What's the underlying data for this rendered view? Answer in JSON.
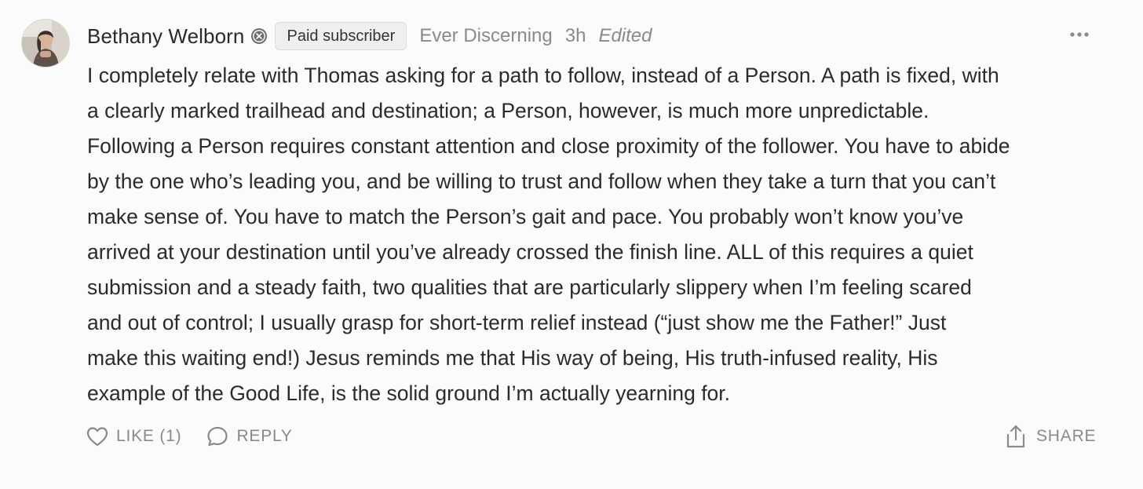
{
  "comment": {
    "author": "Bethany Welborn",
    "badge": "Paid subscriber",
    "publication": "Ever Discerning",
    "time": "3h",
    "edited": "Edited",
    "lines": [
      "I completely relate with Thomas asking for a path to follow, instead of a Person. A path is fixed, with",
      "a clearly marked trailhead and destination; a Person, however, is much more unpredictable.",
      "Following a Person requires constant attention and close proximity of the follower. You have to abide",
      "by the one who’s leading you, and be willing to trust and follow when they take a turn that you can’t",
      "make sense of. You have to match the Person’s gait and pace. You probably won’t know you’ve",
      "arrived at your destination until you’ve already crossed the finish line. ALL of this requires a quiet",
      "submission and a steady faith, two qualities that are particularly slippery when I’m feeling scared",
      "and out of control; I usually grasp for short-term relief instead (“just show me the Father!” Just",
      "make this waiting end!) Jesus reminds me that His way of being, His truth-infused reality, His",
      "example of the Good Life, is the solid ground I’m actually yearning for."
    ]
  },
  "actions": {
    "like_label": "LIKE (1)",
    "reply_label": "REPLY",
    "share_label": "SHARE"
  },
  "icons": {
    "subscriber": "subscriber-icon",
    "more": "more-icon",
    "like": "heart-icon",
    "reply": "speech-bubble-icon",
    "share": "share-icon"
  },
  "colors": {
    "background": "#fbfbfb",
    "text": "#2b2b2b",
    "muted": "#8a8a8a",
    "badge_bg": "#efefef"
  }
}
